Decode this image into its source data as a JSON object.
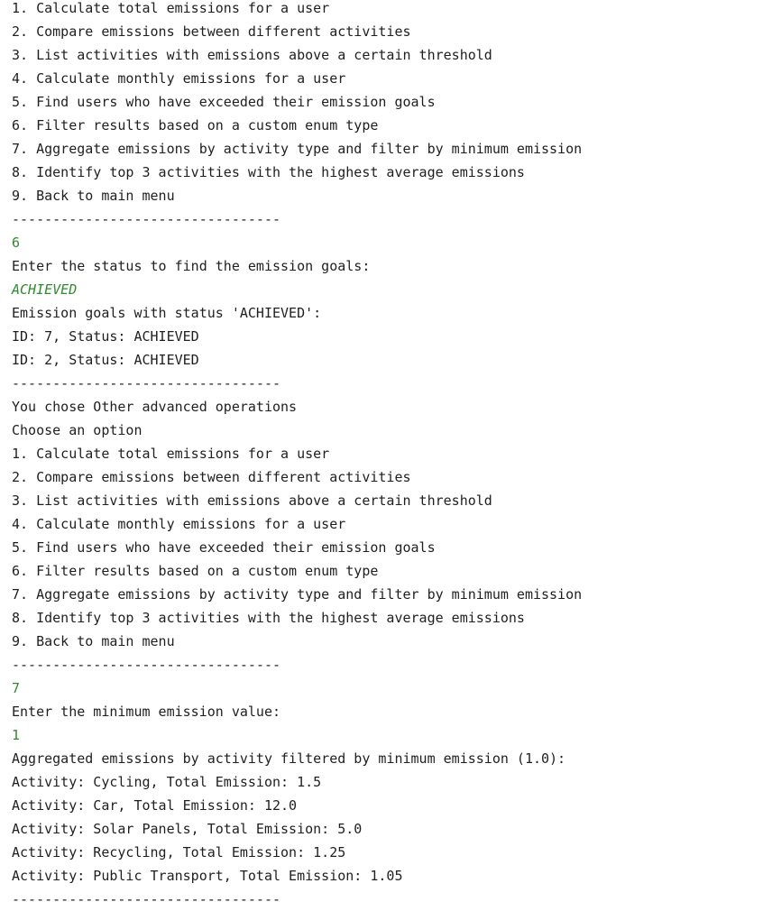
{
  "console": {
    "lines": [
      {
        "text": "1. Calculate total emissions for a user",
        "kind": "output"
      },
      {
        "text": "2. Compare emissions between different activities",
        "kind": "output"
      },
      {
        "text": "3. List activities with emissions above a certain threshold",
        "kind": "output"
      },
      {
        "text": "4. Calculate monthly emissions for a user",
        "kind": "output"
      },
      {
        "text": "5. Find users who have exceeded their emission goals",
        "kind": "output"
      },
      {
        "text": "6. Filter results based on a custom enum type",
        "kind": "output"
      },
      {
        "text": "7. Aggregate emissions by activity type and filter by minimum emission",
        "kind": "output"
      },
      {
        "text": "8. Identify top 3 activities with the highest average emissions",
        "kind": "output"
      },
      {
        "text": "9. Back to main menu",
        "kind": "output"
      },
      {
        "text": "---------------------------------",
        "kind": "separator"
      },
      {
        "text": "6",
        "kind": "input"
      },
      {
        "text": "Enter the status to find the emission goals:",
        "kind": "output"
      },
      {
        "text": "ACHIEVED",
        "kind": "input-italic"
      },
      {
        "text": "Emission goals with status 'ACHIEVED':",
        "kind": "output"
      },
      {
        "text": "ID: 7, Status: ACHIEVED",
        "kind": "output"
      },
      {
        "text": "ID: 2, Status: ACHIEVED",
        "kind": "output"
      },
      {
        "text": "---------------------------------",
        "kind": "separator"
      },
      {
        "text": "You chose Other advanced operations",
        "kind": "output"
      },
      {
        "text": "Choose an option",
        "kind": "output"
      },
      {
        "text": "1. Calculate total emissions for a user",
        "kind": "output"
      },
      {
        "text": "2. Compare emissions between different activities",
        "kind": "output"
      },
      {
        "text": "3. List activities with emissions above a certain threshold",
        "kind": "output"
      },
      {
        "text": "4. Calculate monthly emissions for a user",
        "kind": "output"
      },
      {
        "text": "5. Find users who have exceeded their emission goals",
        "kind": "output"
      },
      {
        "text": "6. Filter results based on a custom enum type",
        "kind": "output"
      },
      {
        "text": "7. Aggregate emissions by activity type and filter by minimum emission",
        "kind": "output"
      },
      {
        "text": "8. Identify top 3 activities with the highest average emissions",
        "kind": "output"
      },
      {
        "text": "9. Back to main menu",
        "kind": "output"
      },
      {
        "text": "---------------------------------",
        "kind": "separator"
      },
      {
        "text": "7",
        "kind": "input"
      },
      {
        "text": "Enter the minimum emission value:",
        "kind": "output"
      },
      {
        "text": "1",
        "kind": "input"
      },
      {
        "text": "Aggregated emissions by activity filtered by minimum emission (1.0):",
        "kind": "output"
      },
      {
        "text": "Activity: Cycling, Total Emission: 1.5",
        "kind": "output"
      },
      {
        "text": "Activity: Car, Total Emission: 12.0",
        "kind": "output"
      },
      {
        "text": "Activity: Solar Panels, Total Emission: 5.0",
        "kind": "output"
      },
      {
        "text": "Activity: Recycling, Total Emission: 1.25",
        "kind": "output"
      },
      {
        "text": "Activity: Public Transport, Total Emission: 1.05",
        "kind": "output"
      },
      {
        "text": "---------------------------------",
        "kind": "separator"
      }
    ]
  },
  "colors": {
    "background": "#ffffff",
    "output_text": "#1f1f1f",
    "user_input_text": "#2e8b2e"
  }
}
